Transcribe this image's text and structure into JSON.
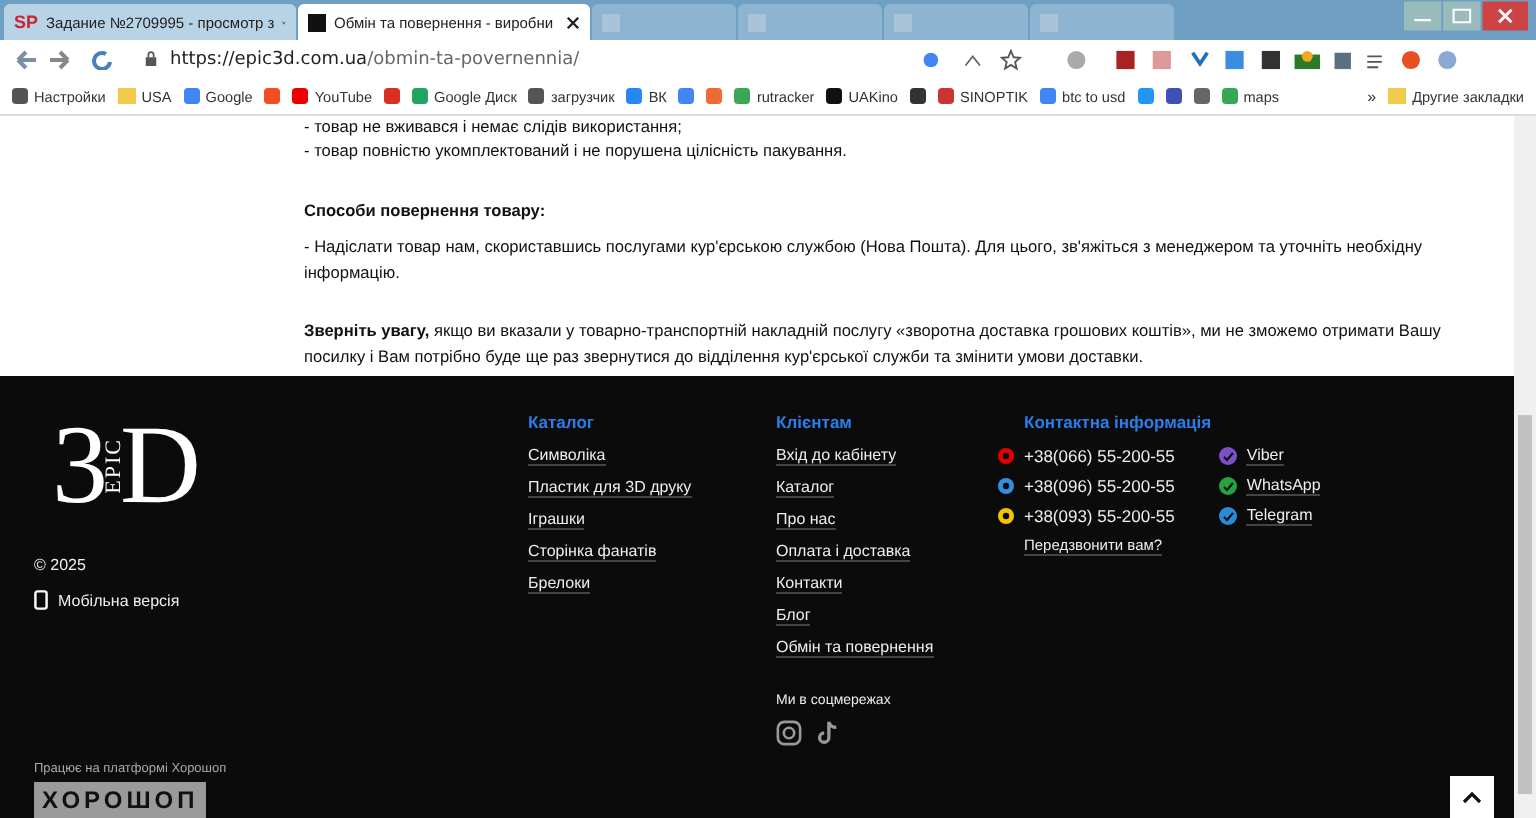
{
  "browser": {
    "tabs": [
      {
        "title": "Задание №2709995 - просмотр з",
        "kind": "sp",
        "favicon": "SP",
        "selected": false
      },
      {
        "title": "Обмін та повернення - виробни",
        "kind": "site",
        "selected": true
      },
      {
        "kind": "blank",
        "selected": false
      },
      {
        "kind": "blank",
        "selected": false
      },
      {
        "kind": "blank",
        "selected": false
      },
      {
        "kind": "blank",
        "selected": false
      }
    ],
    "url_host": "https://epic3d.com.ua",
    "url_path": "/obmin-ta-povernennia/",
    "bookmarks": [
      {
        "label": "Настройки",
        "kind": "gear"
      },
      {
        "label": "USA",
        "kind": "folder"
      },
      {
        "label": "Google",
        "kind": "google"
      },
      {
        "kind": "ya"
      },
      {
        "label": "YouTube",
        "kind": "youtube"
      },
      {
        "kind": "mail"
      },
      {
        "label": "Google Диск",
        "kind": "drive"
      },
      {
        "label": "загрузчик",
        "kind": "globe"
      },
      {
        "label": "ВК",
        "kind": "vk"
      },
      {
        "kind": "translate"
      },
      {
        "kind": "f"
      },
      {
        "label": "rutracker",
        "kind": "flower"
      },
      {
        "label": "UAKino",
        "kind": "dark"
      },
      {
        "kind": "chess"
      },
      {
        "label": "SINOPTIK",
        "kind": "thermo"
      },
      {
        "label": "btc to usd",
        "kind": "google"
      },
      {
        "kind": "p"
      },
      {
        "kind": "chev"
      },
      {
        "kind": "bc"
      },
      {
        "label": "maps",
        "kind": "pin"
      }
    ],
    "more": "»",
    "other": "Другие закладки"
  },
  "content": {
    "paragraphs": [
      {
        "kind": "line",
        "text": "- товар не вживався і немає слідів використання;"
      },
      {
        "kind": "line",
        "text": "- товар повністю укомплектований і не порушена цілісність пакування."
      },
      {
        "kind": "heading",
        "text": "Способи повернення товару:"
      },
      {
        "kind": "para",
        "text": "- Надіслати товар нам, скориставшись послугами кур'єрською службою (Нова Пошта). Для цього, зв'яжіться з менеджером та уточніть необхідну інформацію."
      },
      {
        "kind": "para",
        "text": "**Зверніть увагу,** якщо ви вказали у товарно-транспортній накладній послугу «зворотна доставка грошових коштів», ми не зможемо отримати Вашу посилку і Вам потрібно буде ще раз звернутися до відділення кур'єрської служби та змінити умови доставки."
      }
    ]
  },
  "footer": {
    "logo": {
      "digit": "3",
      "word": "EPIC",
      "letter": "D"
    },
    "copyright": "© 2025",
    "mobile": "Мобільна версія",
    "catalog": {
      "title": "Каталог",
      "links": [
        "Символіка",
        "Пластик для 3D друку",
        "Іграшки",
        "Сторінка фанатів",
        "Брелоки"
      ]
    },
    "clients": {
      "title": "Клієнтам",
      "links": [
        "Вхід до кабінету",
        "Каталог",
        "Про нас",
        "Оплата і доставка",
        "Контакти",
        "Блог",
        "Обмін та повернення"
      ]
    },
    "social_title": "Ми в соцмережах",
    "contacts": {
      "title": "Контактна інформація",
      "phones": [
        {
          "number": "+38(066) 55-200-55",
          "color": "#e60000"
        },
        {
          "number": "+38(096) 55-200-55",
          "color": "#2f8fe0"
        },
        {
          "number": "+38(093) 55-200-55",
          "color": "#f5c400"
        }
      ],
      "callback": "Передзвонити вам?",
      "messengers": [
        {
          "label": "Viber",
          "color": "#7b51c7"
        },
        {
          "label": "WhatsApp",
          "color": "#25a244"
        },
        {
          "label": "Telegram",
          "color": "#2a8bd6"
        }
      ]
    },
    "platform": "Працює на платформі Хорошоп",
    "platform_logo": "ХОРОШОП"
  }
}
